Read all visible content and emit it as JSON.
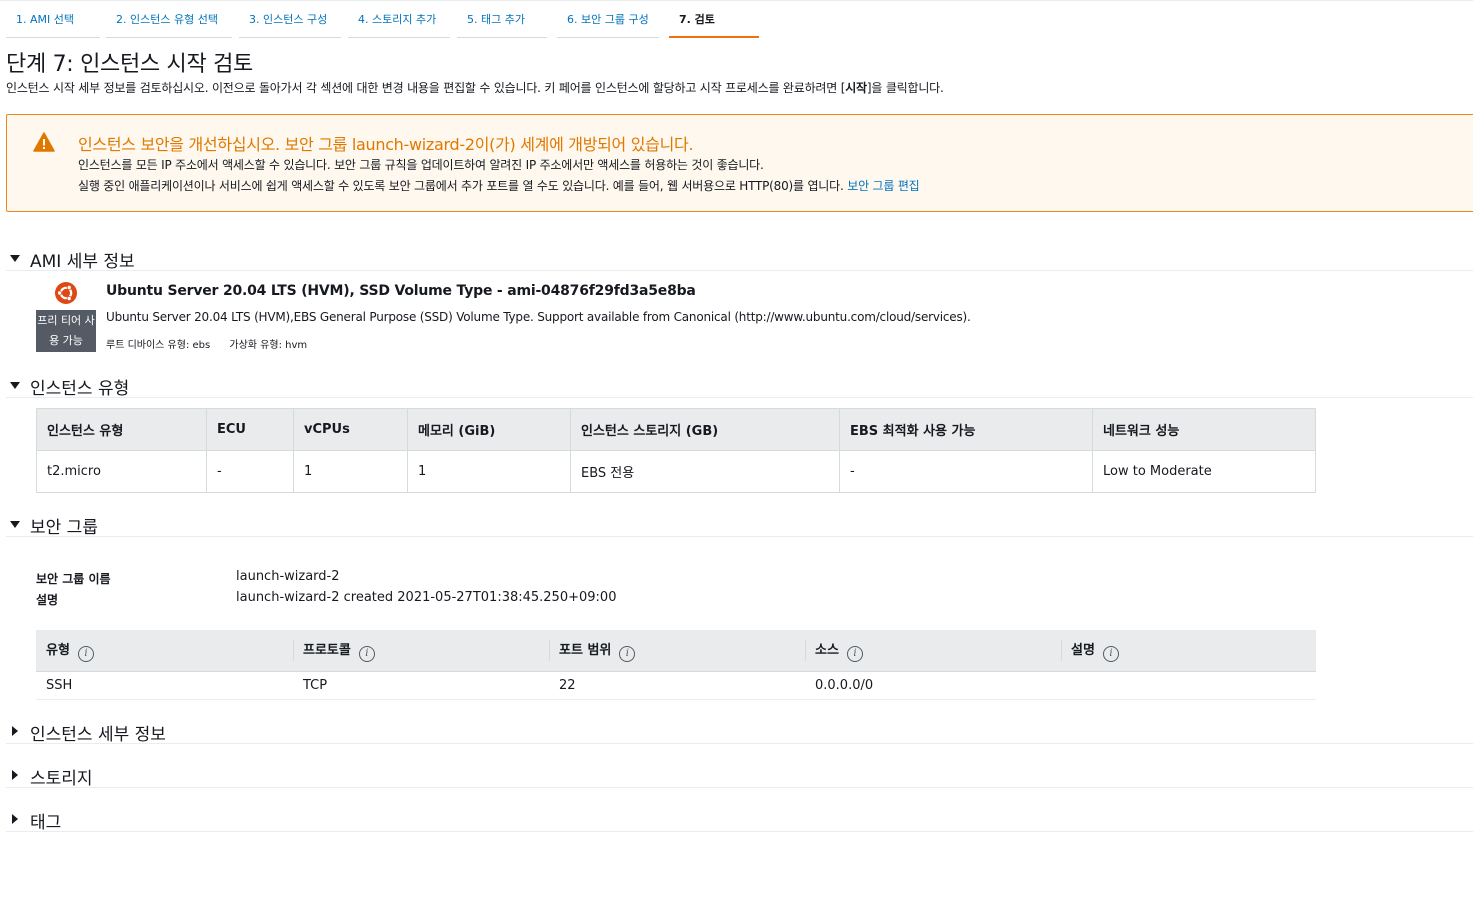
{
  "tabs": [
    {
      "label": "1. AMI 선택"
    },
    {
      "label": "2. 인스턴스 유형 선택"
    },
    {
      "label": "3. 인스턴스 구성"
    },
    {
      "label": "4. 스토리지 추가"
    },
    {
      "label": "5. 태그 추가"
    },
    {
      "label": "6. 보안 그룹 구성"
    },
    {
      "label": "7. 검토"
    }
  ],
  "header": {
    "title": "단계 7: 인스턴스 시작 검토",
    "desc_before": "인스턴스 시작 세부 정보를 검토하십시오. 이전으로 돌아가서 각 섹션에 대한 변경 내용을 편집할 수 있습니다. 키 페어를 인스턴스에 할당하고 시작 프로세스를 완료하려면 [",
    "desc_bold": "시작",
    "desc_after": "]을 클릭합니다."
  },
  "warning": {
    "title": "인스턴스 보안을 개선하십시오. 보안 그룹 launch-wizard-2이(가) 세계에 개방되어 있습니다.",
    "line1": "인스턴스를 모든 IP 주소에서 액세스할 수 있습니다. 보안 그룹 규칙을 업데이트하여 알려진 IP 주소에서만 액세스를 허용하는 것이 좋습니다.",
    "line2": "실행 중인 애플리케이션이나 서비스에 쉽게 액세스할 수 있도록 보안 그룹에서 추가 포트를 열 수도 있습니다. 예를 들어, 웹 서버용으로 HTTP(80)를 엽니다.",
    "link": "보안 그룹 편집"
  },
  "sections": {
    "ami": "AMI 세부 정보",
    "instance_type": "인스턴스 유형",
    "security_group": "보안 그룹",
    "instance_details": "인스턴스 세부 정보",
    "storage": "스토리지",
    "tags": "태그"
  },
  "ami": {
    "free_tier": "프리 티어 사용 가능",
    "name": "Ubuntu Server 20.04 LTS (HVM), SSD Volume Type - ami-04876f29fd3a5e8ba",
    "description": "Ubuntu Server 20.04 LTS (HVM),EBS General Purpose (SSD) Volume Type. Support available from Canonical (http://www.ubuntu.com/cloud/services).",
    "root_device": "루트 디바이스 유형: ebs",
    "virtualization": "가상화 유형: hvm"
  },
  "instance_table": {
    "headers": [
      "인스턴스 유형",
      "ECU",
      "vCPUs",
      "메모리 (GiB)",
      "인스턴스 스토리지 (GB)",
      "EBS 최적화 사용 가능",
      "네트워크 성능"
    ],
    "row": [
      "t2.micro",
      "-",
      "1",
      "1",
      "EBS 전용",
      "-",
      "Low to Moderate"
    ]
  },
  "security_group": {
    "name_label": "보안 그룹 이름",
    "name_value": "launch-wizard-2",
    "desc_label": "설명",
    "desc_value": "launch-wizard-2 created 2021-05-27T01:38:45.250+09:00",
    "rules_headers": [
      "유형",
      "프로토콜",
      "포트 범위",
      "소스",
      "설명"
    ],
    "rules_row": [
      "SSH",
      "TCP",
      "22",
      "0.0.0.0/0",
      ""
    ]
  },
  "colors": {
    "accent": "#ec7211",
    "link": "#0073bb",
    "warning_text": "#e07800",
    "warning_bg": "#fef8ef"
  }
}
